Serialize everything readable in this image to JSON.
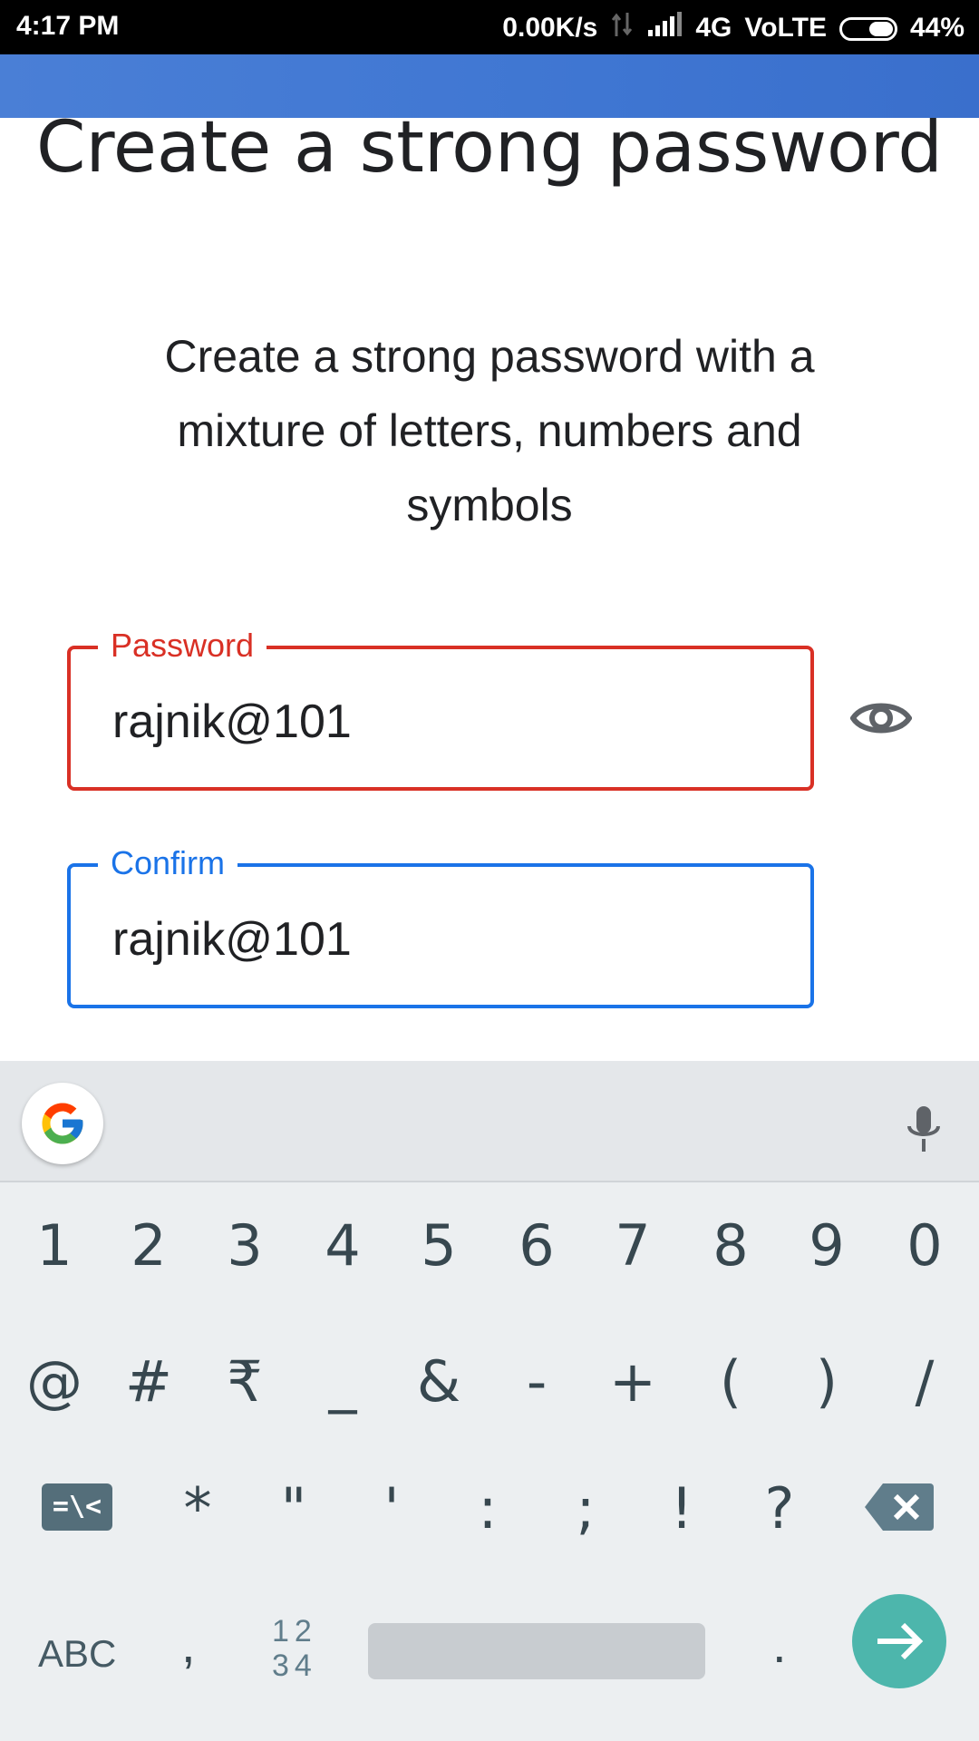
{
  "status_bar": {
    "time": "4:17 PM",
    "net_speed": "0.00K/s",
    "network": "4G",
    "volte": "VoLTE",
    "battery": "44%"
  },
  "page": {
    "title": "Create a strong password",
    "subtitle": "Create a strong password with a mixture of letters, numbers and symbols"
  },
  "password_field": {
    "label": "Password",
    "value": "rajnik@101",
    "border_color": "#d93025"
  },
  "confirm_field": {
    "label": "Confirm",
    "value": "rajnik@101",
    "border_color": "#1a73e8"
  },
  "toggle_visibility_icon": "eye-icon",
  "keyboard": {
    "row1": [
      "1",
      "2",
      "3",
      "4",
      "5",
      "6",
      "7",
      "8",
      "9",
      "0"
    ],
    "row2": [
      "@",
      "#",
      "₹",
      "_",
      "&",
      "-",
      "+",
      "(",
      ")",
      "/"
    ],
    "row3_symbol_key": "=\\<",
    "row3": [
      "*",
      "\"",
      "'",
      ":",
      ";",
      "!",
      "?"
    ],
    "abc_key": "ABC",
    "comma_key": ",",
    "numpad_key_line1": "12",
    "numpad_key_line2": "34",
    "period_key": ".",
    "accent": "#4db6ac"
  }
}
